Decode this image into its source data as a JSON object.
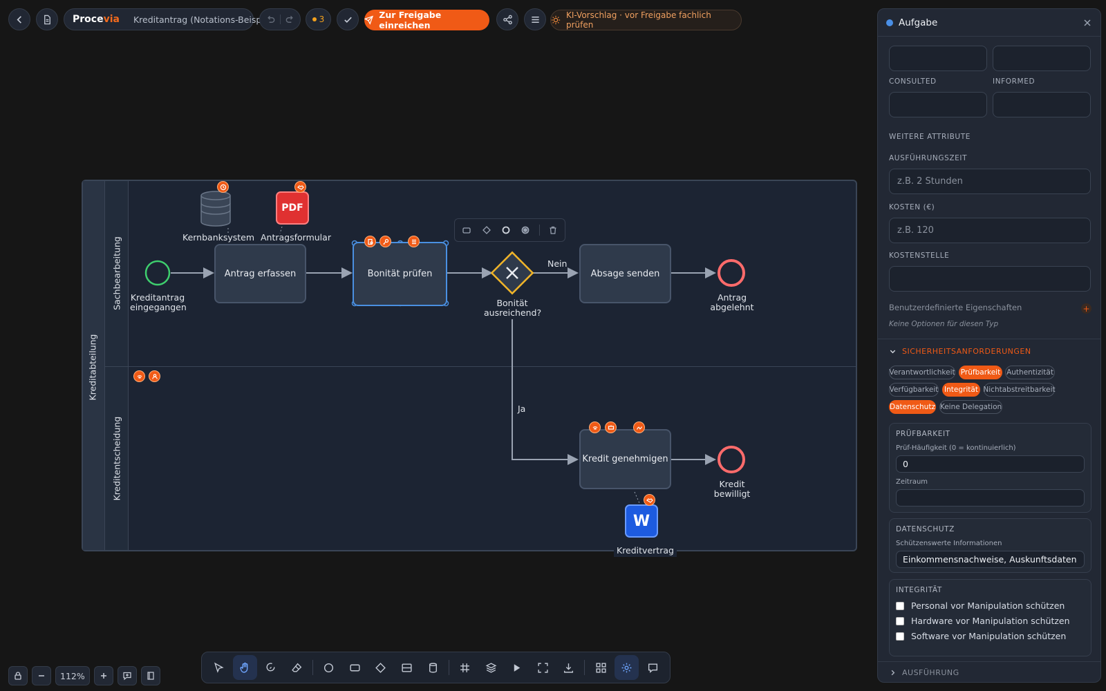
{
  "topbar": {
    "brand_main": "Proce",
    "brand_accent": "via",
    "doc_title": "Kreditantrag (Notations-Beispiel)",
    "counter": "3",
    "submit_label": "Zur Freigabe einreichen",
    "ai_hint": "KI-Vorschlag · vor Freigabe fachlich prüfen"
  },
  "diagram": {
    "pool_label": "Kreditabteilung",
    "lanes": [
      "Sachbearbeitung",
      "Kreditentscheidung"
    ],
    "start_event": "Kreditantrag eingegangen",
    "tasks": {
      "erfassen": "Antrag erfassen",
      "pruefen": "Bonität prüfen",
      "absage": "Absage senden",
      "genehmigen": "Kredit genehmigen"
    },
    "gateway_label": "Bonität ausreichend?",
    "flow_no": "Nein",
    "flow_yes": "Ja",
    "end_rejected": "Antrag abgelehnt",
    "end_approved": "Kredit bewilligt",
    "data_store": "Kernbanksystem",
    "data_form": "Antragsformular",
    "form_icon_text": "PDF",
    "contract": "Kreditvertrag",
    "contract_icon_text": "W"
  },
  "bottom": {
    "zoom": "112%"
  },
  "panel": {
    "title": "Aufgabe",
    "consulted_label": "CONSULTED",
    "informed_label": "INFORMED",
    "more_attrs": "WEITERE ATTRIBUTE",
    "exec_time_label": "AUSFÜHRUNGSZEIT",
    "exec_time_placeholder": "z.B. 2 Stunden",
    "cost_label": "KOSTEN (€)",
    "cost_placeholder": "z.B. 120",
    "cost_center_label": "KOSTENSTELLE",
    "custom_props": "Benutzerdefinierte Eigenschaften",
    "no_options": "Keine Optionen für diesen Typ",
    "security_header": "SICHERHEITSANFORDERUNGEN",
    "chips": [
      {
        "label": "Verantwortlichkeit",
        "active": false
      },
      {
        "label": "Prüfbarkeit",
        "active": true
      },
      {
        "label": "Authentizität",
        "active": false
      },
      {
        "label": "Verfügbarkeit",
        "active": false
      },
      {
        "label": "Integrität",
        "active": true
      },
      {
        "label": "Nichtabstreitbarkeit",
        "active": false
      },
      {
        "label": "Datenschutz",
        "active": true
      },
      {
        "label": "Keine Delegation",
        "active": false
      }
    ],
    "audit": {
      "title": "PRÜFBARKEIT",
      "freq_label": "Prüf-Häufigkeit (0 = kontinuierlich)",
      "freq_value": "0",
      "period_label": "Zeitraum"
    },
    "privacy": {
      "title": "DATENSCHUTZ",
      "info_label": "Schützenswerte Informationen",
      "info_value": "Einkommensnachweise, Auskunftsdaten"
    },
    "integrity": {
      "title": "INTEGRITÄT",
      "items": [
        "Personal vor Manipulation schützen",
        "Hardware vor Manipulation schützen",
        "Software vor Manipulation schützen"
      ]
    },
    "execution_header": "AUSFÜHRUNG"
  },
  "colors": {
    "accent": "#f05a16",
    "selection": "#4a90e2",
    "start_event": "#3ecf6e",
    "end_event": "#ff6b6b",
    "gateway": "#f0b429"
  }
}
